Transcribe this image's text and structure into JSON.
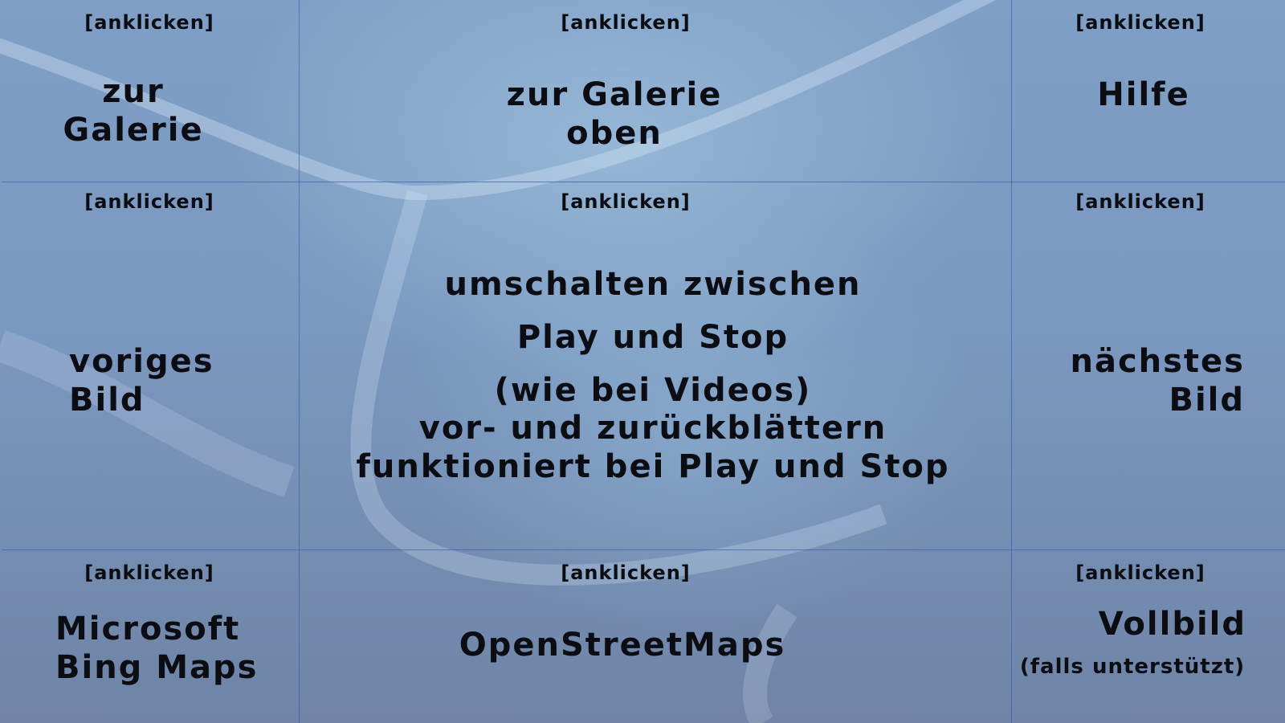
{
  "hint_text": "[anklicken]",
  "cells": {
    "top_left": {
      "lines": [
        "zur",
        "Galerie"
      ]
    },
    "top_center": {
      "lines": [
        "zur Galerie",
        "oben"
      ]
    },
    "top_right": {
      "lines": [
        "Hilfe"
      ]
    },
    "mid_left": {
      "lines": [
        "voriges",
        "Bild"
      ]
    },
    "mid_center": {
      "lines": [
        "umschalten zwischen",
        "Play und Stop",
        "(wie bei Videos)",
        "vor- und zurückblättern",
        "funktioniert bei Play und Stop"
      ]
    },
    "mid_right": {
      "lines": [
        "nächstes",
        "Bild"
      ]
    },
    "bot_left": {
      "lines": [
        "Microsoft",
        "Bing Maps"
      ]
    },
    "bot_center": {
      "lines": [
        "OpenStreetMaps"
      ]
    },
    "bot_right": {
      "title": "Vollbild",
      "note": "(falls unterstützt)"
    }
  },
  "colors": {
    "grid_line": "#3f63b0",
    "text": "#0b0d12"
  }
}
